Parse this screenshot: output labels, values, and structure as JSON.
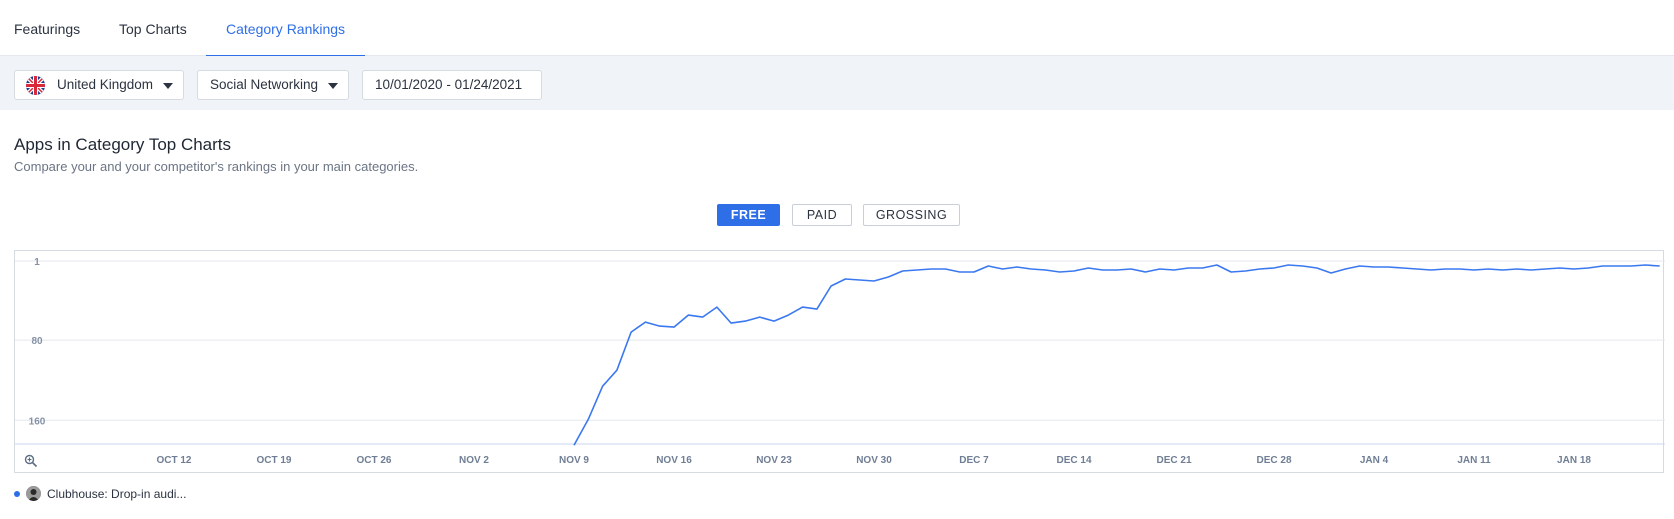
{
  "tabs": [
    {
      "label": "Featurings",
      "active": false
    },
    {
      "label": "Top Charts",
      "active": false
    },
    {
      "label": "Category Rankings",
      "active": true
    }
  ],
  "filters": {
    "country": "United Kingdom",
    "category": "Social Networking",
    "date_range": "10/01/2020 - 01/24/2021"
  },
  "section": {
    "title": "Apps in Category Top Charts",
    "subtitle": "Compare your and your competitor's rankings in your main categories."
  },
  "chart_types": [
    {
      "label": "FREE",
      "active": true
    },
    {
      "label": "PAID",
      "active": false
    },
    {
      "label": "GROSSING",
      "active": false
    }
  ],
  "colors": {
    "accent": "#2e6ee6",
    "line": "#3a78f0"
  },
  "legend": [
    {
      "label": "Clubhouse: Drop-in audi..."
    }
  ],
  "chart_data": {
    "type": "line",
    "y_reversed": true,
    "ylim": [
      1,
      240
    ],
    "y_ticks": [
      "1",
      "80",
      "160"
    ],
    "y_tick_values": [
      1,
      80,
      160
    ],
    "x_tick_labels": [
      "OCT 12",
      "OCT 19",
      "OCT 26",
      "NOV 2",
      "NOV 9",
      "NOV 16",
      "NOV 23",
      "NOV 30",
      "DEC 7",
      "DEC 14",
      "DEC 21",
      "DEC 28",
      "JAN 4",
      "JAN 11",
      "JAN 18"
    ],
    "grid": true,
    "series": [
      {
        "name": "Clubhouse: Drop-in audi...",
        "x": [
          "2020-11-09",
          "2020-11-10",
          "2020-11-11",
          "2020-11-12",
          "2020-11-13",
          "2020-11-14",
          "2020-11-15",
          "2020-11-16",
          "2020-11-17",
          "2020-11-18",
          "2020-11-19",
          "2020-11-20",
          "2020-11-21",
          "2020-11-22",
          "2020-11-23",
          "2020-11-24",
          "2020-11-25",
          "2020-11-26",
          "2020-11-27",
          "2020-11-28",
          "2020-11-29",
          "2020-11-30",
          "2020-12-01",
          "2020-12-02",
          "2020-12-03",
          "2020-12-04",
          "2020-12-05",
          "2020-12-06",
          "2020-12-07",
          "2020-12-08",
          "2020-12-09",
          "2020-12-10",
          "2020-12-11",
          "2020-12-12",
          "2020-12-13",
          "2020-12-14",
          "2020-12-15",
          "2020-12-16",
          "2020-12-17",
          "2020-12-18",
          "2020-12-19",
          "2020-12-20",
          "2020-12-21",
          "2020-12-22",
          "2020-12-23",
          "2020-12-24",
          "2020-12-25",
          "2020-12-26",
          "2020-12-27",
          "2020-12-28",
          "2020-12-29",
          "2020-12-30",
          "2020-12-31",
          "2021-01-01",
          "2021-01-02",
          "2021-01-03",
          "2021-01-04",
          "2021-01-05",
          "2021-01-06",
          "2021-01-07",
          "2021-01-08",
          "2021-01-09",
          "2021-01-10",
          "2021-01-11",
          "2021-01-12",
          "2021-01-13",
          "2021-01-14",
          "2021-01-15",
          "2021-01-16",
          "2021-01-17",
          "2021-01-18",
          "2021-01-19",
          "2021-01-20",
          "2021-01-21",
          "2021-01-22",
          "2021-01-23",
          "2021-01-24"
        ],
        "y": [
          185,
          159,
          126,
          110,
          72,
          62,
          66,
          67,
          55,
          57,
          47,
          63,
          61,
          57,
          61,
          55,
          47,
          49,
          26,
          19,
          20,
          21,
          17,
          11,
          10,
          9,
          9,
          12,
          12,
          6,
          9,
          7,
          9,
          10,
          12,
          11,
          8,
          10,
          10,
          9,
          12,
          9,
          10,
          8,
          8,
          5,
          12,
          11,
          9,
          8,
          5,
          6,
          8,
          13,
          9,
          6,
          7,
          7,
          8,
          9,
          10,
          9,
          9,
          10,
          9,
          10,
          9,
          10,
          9,
          8,
          9,
          8,
          6,
          6,
          6,
          5,
          6
        ]
      }
    ]
  }
}
